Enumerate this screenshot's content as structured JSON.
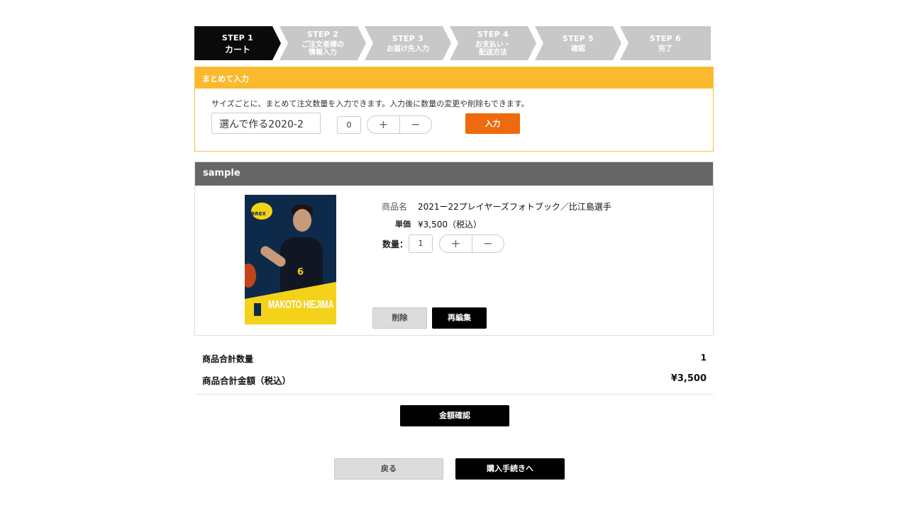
{
  "steps": [
    {
      "num": "STEP 1",
      "label": "カート",
      "active": true
    },
    {
      "num": "STEP 2",
      "label": "ご注文者様の\n情報入力",
      "active": false
    },
    {
      "num": "STEP 3",
      "label": "お届け先入力",
      "active": false
    },
    {
      "num": "STEP 4",
      "label": "お支払い・\n配送方法",
      "active": false
    },
    {
      "num": "STEP 5",
      "label": "確認",
      "active": false
    },
    {
      "num": "STEP 6",
      "label": "完了",
      "active": false
    }
  ],
  "bulk": {
    "title": "まとめて入力",
    "description": "サイズごとに、まとめて注文数量を入力できます。入力後に数量の変更や削除もできます。",
    "select_value": "選んで作る2020-2",
    "qty_value": "0",
    "plus": "+",
    "minus": "−",
    "enter_label": "入力"
  },
  "item": {
    "header": "sample",
    "photo_name": "MAKOTO HIEJIMA",
    "photo_logo": "BREX",
    "photo_number": "6",
    "name_label": "商品名",
    "name_value": "2021ー22プレイヤーズフォトブック／比江島選手",
    "price_label": "単価",
    "price_value": "¥3,500（税込）",
    "qty_label": "数量：",
    "qty_value": "1",
    "plus": "+",
    "minus": "−",
    "delete_label": "削除",
    "edit_label": "再編集"
  },
  "totals": {
    "count_label": "商品合計数量",
    "count_value": "1",
    "amount_label": "商品合計金額（税込）",
    "amount_value": "¥3,500"
  },
  "buttons": {
    "confirm": "金額確認",
    "back": "戻る",
    "proceed": "購入手続きへ"
  },
  "colors": {
    "accent_orange": "#ee6a0c",
    "bulk_yellow": "#fbb92d",
    "active_step": "#0a0a0a",
    "inactive_step": "#c8c8c8"
  }
}
